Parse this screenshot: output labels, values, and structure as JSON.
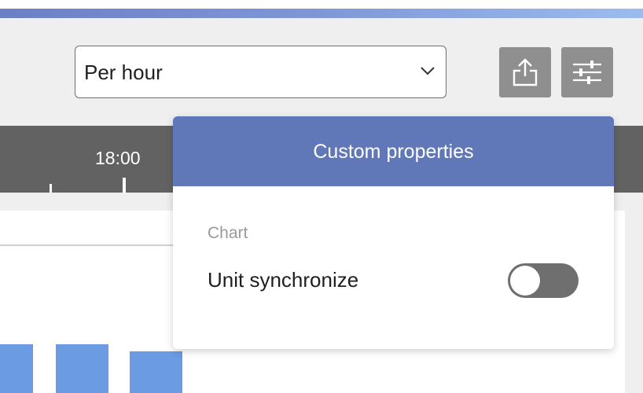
{
  "header": {
    "period_select": {
      "value": "Per hour"
    },
    "icons": [
      "chevron-down-icon",
      "share-icon",
      "sliders-icon"
    ],
    "button_color": "#8f8f8f"
  },
  "timeline": {
    "label": "18:00",
    "background": "#626262"
  },
  "chart": {
    "bar_color": "#6a9be3"
  },
  "popup": {
    "title": "Custom properties",
    "header_color": "#6178b8",
    "section": "Chart",
    "settings": [
      {
        "label": "Unit synchronize",
        "enabled": false
      }
    ]
  }
}
